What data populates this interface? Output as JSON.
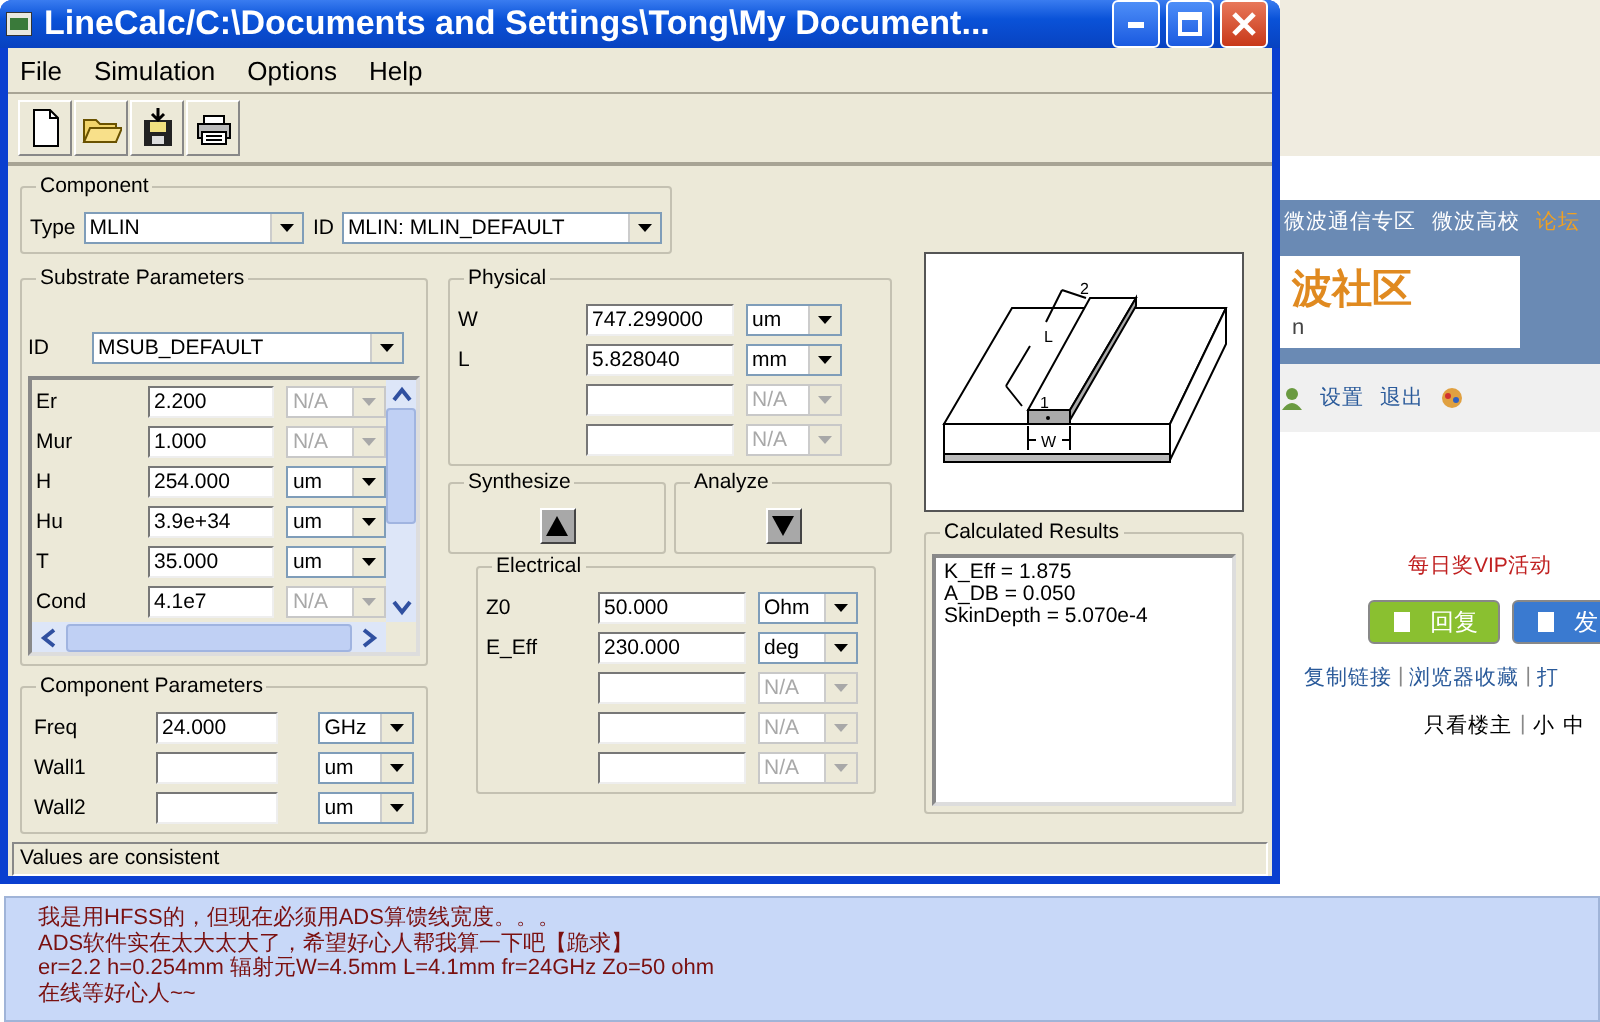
{
  "window": {
    "title": "LineCalc/C:\\Documents and Settings\\Tong\\My Document..."
  },
  "menu": [
    "File",
    "Simulation",
    "Options",
    "Help"
  ],
  "component": {
    "title": "Component",
    "type_label": "Type",
    "type": "MLIN",
    "id_label": "ID",
    "id": "MLIN: MLIN_DEFAULT"
  },
  "substrate": {
    "title": "Substrate Parameters",
    "id_label": "ID",
    "id": "MSUB_DEFAULT",
    "params": [
      {
        "label": "Er",
        "value": "2.200",
        "unit": "N/A",
        "disabled": true
      },
      {
        "label": "Mur",
        "value": "1.000",
        "unit": "N/A",
        "disabled": true
      },
      {
        "label": "H",
        "value": "254.000",
        "unit": "um",
        "disabled": false
      },
      {
        "label": "Hu",
        "value": "3.9e+34",
        "unit": "um",
        "disabled": false
      },
      {
        "label": "T",
        "value": "35.000",
        "unit": "um",
        "disabled": false
      },
      {
        "label": "Cond",
        "value": "4.1e7",
        "unit": "N/A",
        "disabled": true
      }
    ]
  },
  "component_parameters": {
    "title": "Component Parameters",
    "params": [
      {
        "label": "Freq",
        "value": "24.000",
        "unit": "GHz",
        "disabled": false
      },
      {
        "label": "Wall1",
        "unit": "um",
        "disabled": false
      },
      {
        "label": "Wall2",
        "unit": "um",
        "disabled": false
      }
    ]
  },
  "physical": {
    "title": "Physical",
    "params": [
      {
        "label": "W",
        "value": "747.299000",
        "unit": "um",
        "disabled": false
      },
      {
        "label": "L",
        "value": "5.828040",
        "unit": "mm",
        "disabled": false
      },
      {
        "unit": "N/A",
        "disabled": true
      },
      {
        "unit": "N/A",
        "disabled": true
      }
    ]
  },
  "synthesize": {
    "title": "Synthesize"
  },
  "analyze": {
    "title": "Analyze"
  },
  "electrical": {
    "title": "Electrical",
    "params": [
      {
        "label": "Z0",
        "value": "50.000",
        "unit": "Ohm",
        "disabled": false
      },
      {
        "label": "E_Eff",
        "value": "230.000",
        "unit": "deg",
        "disabled": false
      },
      {
        "unit": "N/A",
        "disabled": true
      },
      {
        "unit": "N/A",
        "disabled": true
      },
      {
        "unit": "N/A",
        "disabled": true
      }
    ]
  },
  "diagram": {
    "port_2": "2",
    "length": "L",
    "port_1": "1",
    "width": "W"
  },
  "results": {
    "title": "Calculated Results",
    "lines": [
      "K_Eff = 1.875",
      "A_DB = 0.050",
      "SkinDepth = 5.070e-4"
    ]
  },
  "status_bar": "Values are consistent",
  "background_page": {
    "nav": [
      "微波通信专区",
      "微波高校",
      "论坛"
    ],
    "logo": "波社区",
    "logo_sub": "n",
    "tools": [
      "设置",
      "退出"
    ],
    "promo": "每日奖VIP活动",
    "reply_button": "回复",
    "post_button": "发",
    "separator": "|",
    "links": [
      "复制链接",
      "浏览器收藏",
      "打"
    ],
    "view": [
      "只看楼主",
      "小",
      "中"
    ]
  },
  "post": {
    "lines": [
      "我是用HFSS的，但现在必须用ADS算馈线宽度。。。",
      "ADS软件实在太大太大了，希望好心人帮我算一下吧【跪求】",
      "er=2.2  h=0.254mm  辐射元W=4.5mm L=4.1mm  fr=24GHz  Zo=50 ohm",
      "在线等好心人~~"
    ]
  }
}
